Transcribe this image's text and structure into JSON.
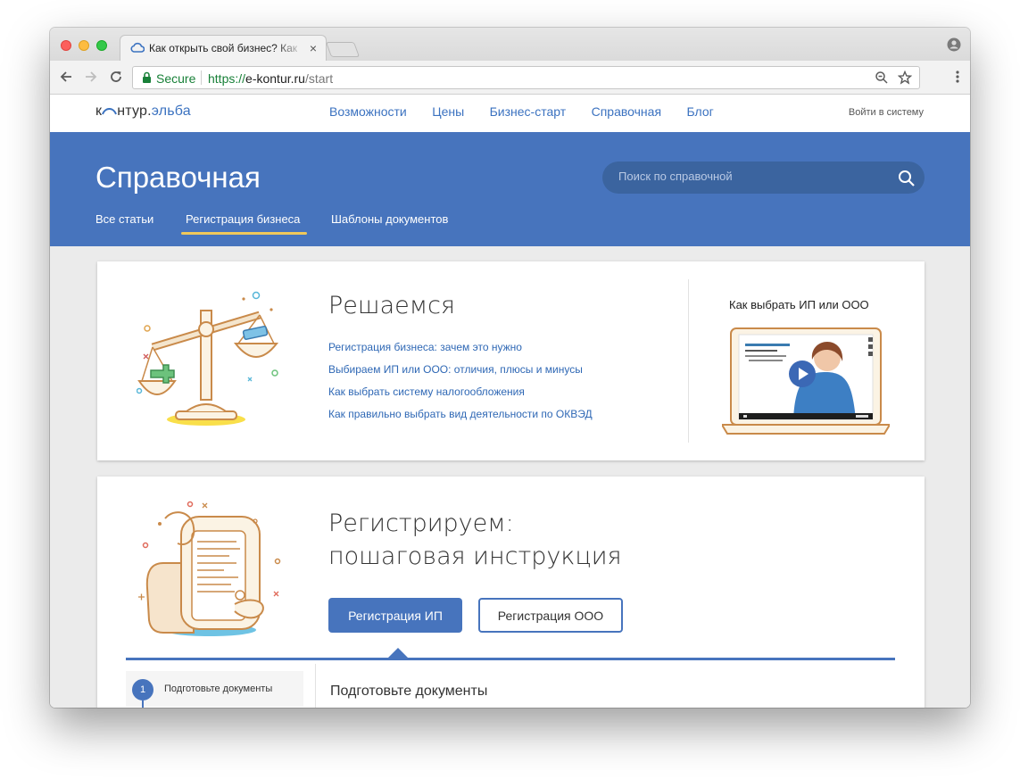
{
  "browser": {
    "tab_title": "Как открыть свой бизнес? Как",
    "tab_close": "×",
    "secure_label": "Secure",
    "url_scheme": "https://",
    "url_host": "e-kontur.ru",
    "url_path": "/start"
  },
  "site": {
    "logo_part1": "к",
    "logo_part2": "нтур.",
    "logo_part3": "эльба",
    "nav": [
      "Возможности",
      "Цены",
      "Бизнес-старт",
      "Справочная",
      "Блог"
    ],
    "login": "Войти в систему"
  },
  "hero": {
    "title": "Справочная",
    "search_placeholder": "Поиск по справочной",
    "tabs": [
      "Все статьи",
      "Регистрация бизнеса",
      "Шаблоны документов"
    ],
    "active_tab": 1
  },
  "card1": {
    "title": "Решаемся",
    "links": [
      "Регистрация бизнеса: зачем это нужно",
      "Выбираем ИП или ООО: отличия, плюсы и минусы",
      "Как выбрать систему налогообложения",
      "Как правильно выбрать вид деятельности по ОКВЭД"
    ],
    "video_title": "Как выбрать ИП или ООО"
  },
  "card2": {
    "title_line1": "Регистрируем:",
    "title_line2": "пошаговая инструкция",
    "btn_ip": "Регистрация ИП",
    "btn_ooo": "Регистрация ООО",
    "step_number": "1",
    "step_label": "Подготовьте документы",
    "step_heading": "Подготовьте документы"
  },
  "colors": {
    "brand_blue": "#4774bd",
    "link_blue": "#2f68b5",
    "tab_underline": "#f0c85a"
  }
}
